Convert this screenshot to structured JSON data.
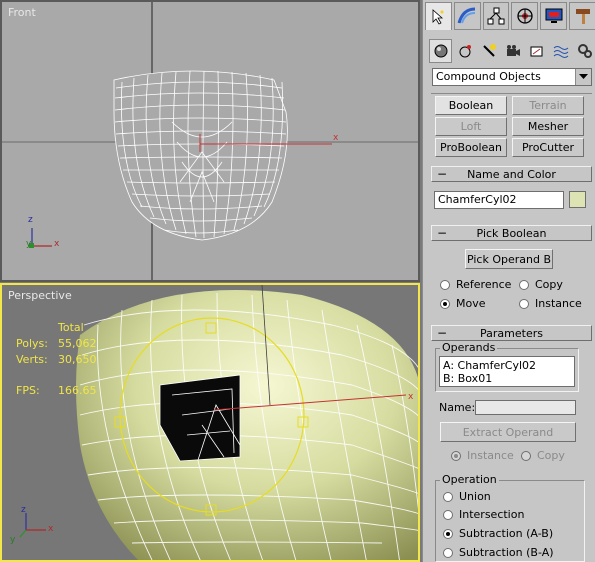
{
  "viewports": {
    "front": {
      "label": "Front",
      "axis_z": "z",
      "axis_y": "y",
      "axis_x": "x",
      "pivot_x": "x"
    },
    "perspective": {
      "label": "Perspective",
      "stats": {
        "header": "Total",
        "polys_label": "Polys:",
        "polys_value": "55,062",
        "verts_label": "Verts:",
        "verts_value": "30,650",
        "fps_label": "FPS:",
        "fps_value": "166.65"
      },
      "axis_z": "z",
      "axis_y": "y",
      "axis_x": "x",
      "gizmo_x": "x"
    }
  },
  "panel": {
    "tabs": [
      {
        "name": "create-tab",
        "icon": "cursor-arrow-icon",
        "active": true
      },
      {
        "name": "modify-tab",
        "icon": "modify-rainbow-icon"
      },
      {
        "name": "hierarchy-tab",
        "icon": "hierarchy-icon"
      },
      {
        "name": "motion-tab",
        "icon": "motion-wheel-icon"
      },
      {
        "name": "display-tab",
        "icon": "display-monitor-icon"
      },
      {
        "name": "utilities-tab",
        "icon": "hammer-icon"
      }
    ],
    "subtabs": [
      "geometry-icon",
      "shapes-icon",
      "lights-icon",
      "cameras-icon",
      "helpers-icon",
      "spacewarps-icon",
      "systems-icon"
    ],
    "category_dropdown": "Compound Objects",
    "object_types": {
      "boolean": "Boolean",
      "terrain": "Terrain",
      "loft": "Loft",
      "mesher": "Mesher",
      "proboolean": "ProBoolean",
      "procutter": "ProCutter"
    },
    "name_color": {
      "title": "Name and Color",
      "name_value": "ChamferCyl02",
      "color": "#dde3b2"
    },
    "pick_boolean": {
      "title": "Pick Boolean",
      "button": "Pick Operand B",
      "reference": "Reference",
      "copy": "Copy",
      "move": "Move",
      "instance": "Instance"
    },
    "parameters": {
      "title": "Parameters",
      "operands_title": "Operands",
      "operands": [
        "A: ChamferCyl02",
        "B: Box01"
      ],
      "name_label": "Name:",
      "name_value": "",
      "extract_button": "Extract Operand",
      "extract_instance": "Instance",
      "extract_copy": "Copy",
      "operation_title": "Operation",
      "union": "Union",
      "intersection": "Intersection",
      "subtraction_ab": "Subtraction (A-B)",
      "subtraction_ba": "Subtraction (B-A)"
    }
  }
}
